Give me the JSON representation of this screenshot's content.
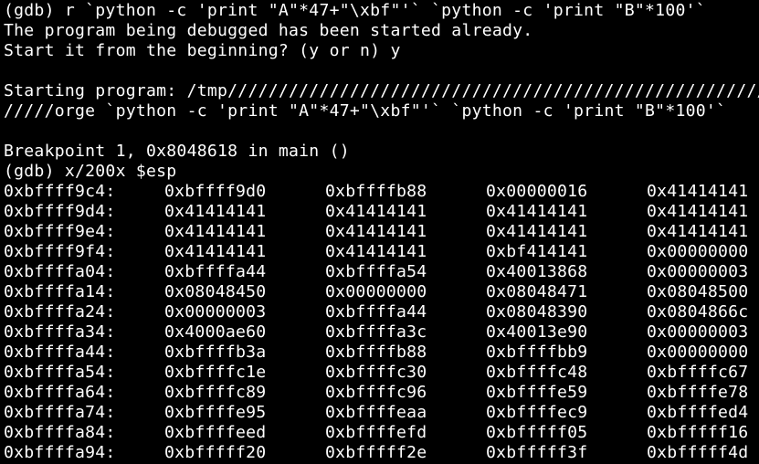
{
  "terminal": {
    "lines": [
      "(gdb) r `python -c 'print \"A\"*47+\"\\xbf\"'` `python -c 'print \"B\"*100'`",
      "The program being debugged has been started already.",
      "Start it from the beginning? (y or n) y",
      "",
      "Starting program: /tmp//////////////////////////////////////////////////////////////////////",
      "/////orge `python -c 'print \"A\"*47+\"\\xbf\"'` `python -c 'print \"B\"*100'`",
      "",
      "Breakpoint 1, 0x8048618 in main ()",
      "(gdb) x/200x $esp"
    ],
    "memory_dump": [
      [
        "0xbffff9c4:",
        "0xbffff9d0",
        "0xbffffb88",
        "0x00000016",
        "0x41414141"
      ],
      [
        "0xbffff9d4:",
        "0x41414141",
        "0x41414141",
        "0x41414141",
        "0x41414141"
      ],
      [
        "0xbffff9e4:",
        "0x41414141",
        "0x41414141",
        "0x41414141",
        "0x41414141"
      ],
      [
        "0xbffff9f4:",
        "0x41414141",
        "0x41414141",
        "0xbf414141",
        "0x00000000"
      ],
      [
        "0xbffffa04:",
        "0xbffffa44",
        "0xbffffa54",
        "0x40013868",
        "0x00000003"
      ],
      [
        "0xbffffa14:",
        "0x08048450",
        "0x00000000",
        "0x08048471",
        "0x08048500"
      ],
      [
        "0xbffffa24:",
        "0x00000003",
        "0xbffffa44",
        "0x08048390",
        "0x0804866c"
      ],
      [
        "0xbffffa34:",
        "0x4000ae60",
        "0xbffffa3c",
        "0x40013e90",
        "0x00000003"
      ],
      [
        "0xbffffa44:",
        "0xbffffb3a",
        "0xbffffb88",
        "0xbffffbb9",
        "0x00000000"
      ],
      [
        "0xbffffa54:",
        "0xbffffc1e",
        "0xbffffc30",
        "0xbffffc48",
        "0xbffffc67"
      ],
      [
        "0xbffffa64:",
        "0xbffffc89",
        "0xbffffc96",
        "0xbffffe59",
        "0xbffffe78"
      ],
      [
        "0xbffffa74:",
        "0xbffffe95",
        "0xbffffeaa",
        "0xbffffec9",
        "0xbffffed4"
      ],
      [
        "0xbffffa84:",
        "0xbffffeed",
        "0xbffffefd",
        "0xbfffff05",
        "0xbfffff16"
      ],
      [
        "0xbffffa94:",
        "0xbfffff20",
        "0xbfffff2e",
        "0xbfffff3f",
        "0xbfffff4d"
      ]
    ]
  }
}
